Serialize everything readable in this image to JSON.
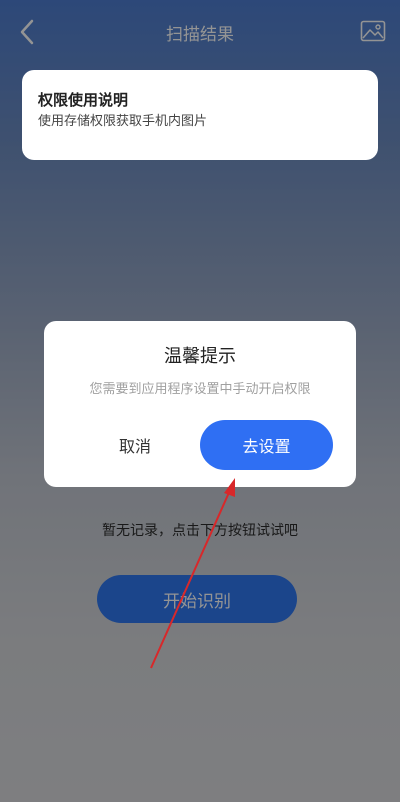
{
  "nav": {
    "title": "扫描结果",
    "back_icon": "chevron-left-icon",
    "gallery_icon": "image-icon"
  },
  "permission_banner": {
    "title": "权限使用说明",
    "description": "使用存储权限获取手机内图片"
  },
  "dialog": {
    "title": "温馨提示",
    "message": "您需要到应用程序设置中手动开启权限",
    "cancel_label": "取消",
    "confirm_label": "去设置"
  },
  "main": {
    "empty_text": "暂无记录，点击下方按钮试试吧",
    "start_label": "开始识别"
  },
  "colors": {
    "accent": "#2f6ff3",
    "annotation_arrow": "#d8282a"
  }
}
